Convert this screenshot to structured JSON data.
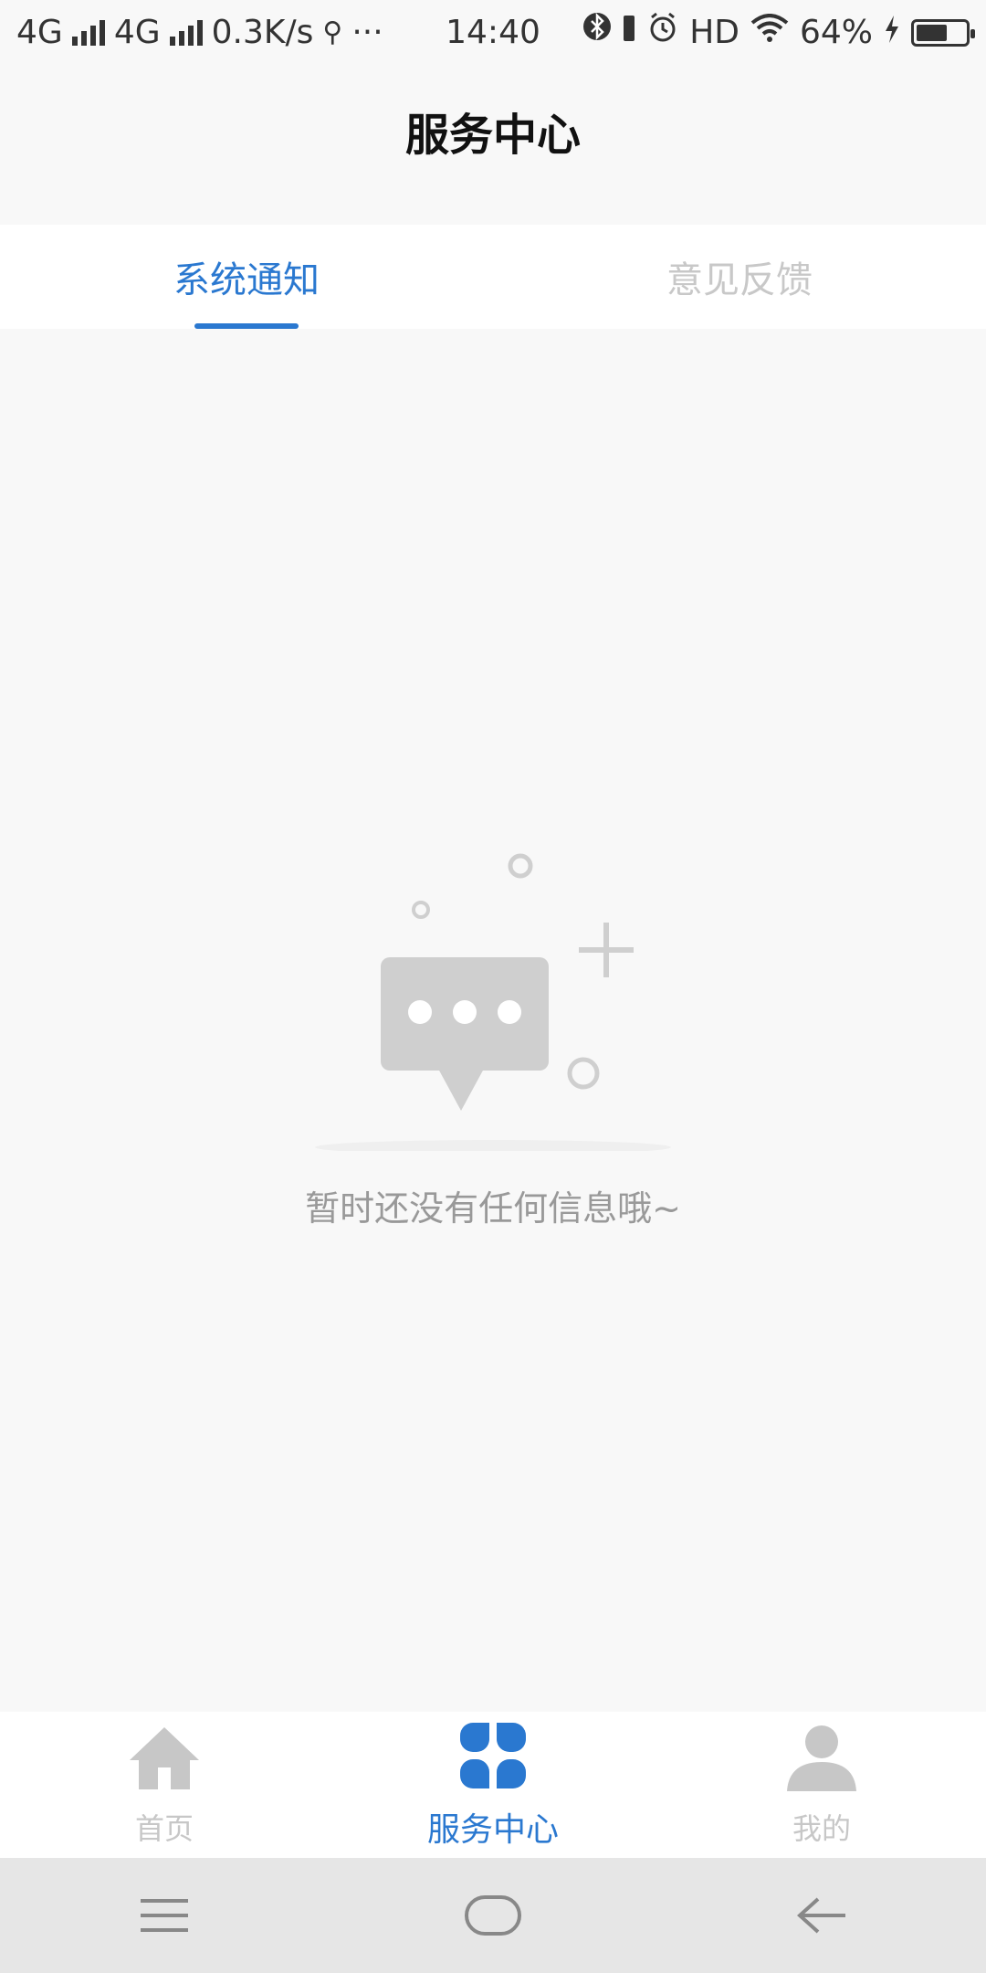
{
  "status_bar": {
    "network1": "4G",
    "network2": "4G",
    "speed": "0.3K/s",
    "more": "···",
    "time": "14:40",
    "hd": "HD",
    "battery": "64%",
    "battery_level": 0.64
  },
  "header": {
    "title": "服务中心"
  },
  "tabs": [
    {
      "label": "系统通知",
      "active": true
    },
    {
      "label": "意见反馈",
      "active": false
    }
  ],
  "empty_state": {
    "message": "暂时还没有任何信息哦~"
  },
  "bottom_nav": [
    {
      "label": "首页",
      "icon": "home-icon",
      "active": false
    },
    {
      "label": "服务中心",
      "icon": "grid-icon",
      "active": true
    },
    {
      "label": "我的",
      "icon": "user-icon",
      "active": false
    }
  ],
  "colors": {
    "accent": "#2a78d0",
    "inactive": "#c7c7c7",
    "background": "#f8f8f8"
  }
}
